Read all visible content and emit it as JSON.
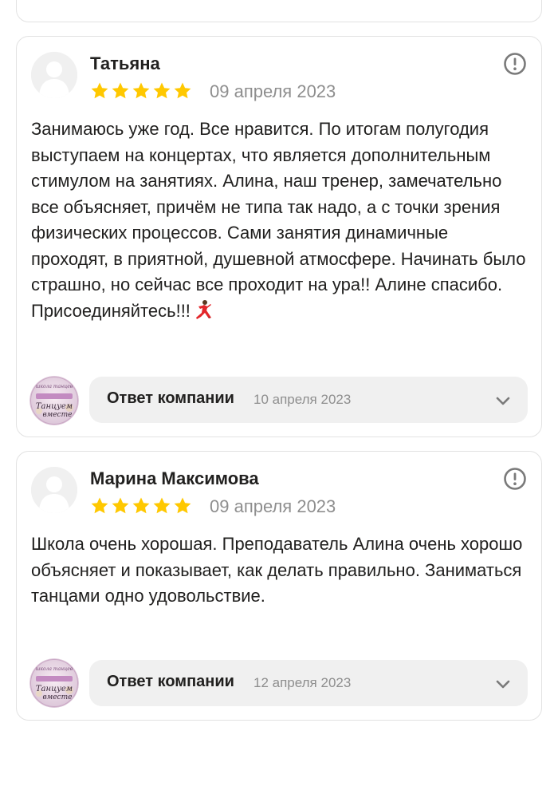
{
  "reviews": [
    {
      "author": "Татьяна",
      "rating": 5,
      "date": "09 апреля 2023",
      "text": "Занимаюсь уже год. Все нравится. По итогам полугодия выступаем на концертах, что является дополнительным стимулом на занятиях. Алина, наш тренер, замечательно все объясняет, причём не типа так надо, а с точки зрения физических процессов. Сами занятия динамичные проходят, в приятной, душевной атмосфере. Начинать было страшно, но сейчас все проходит на ура!! Алине спасибо. Присоединяйтесь!!!",
      "emoji": "dancer-emoji",
      "reply": {
        "label": "Ответ компании",
        "date": "10 апреля 2023"
      }
    },
    {
      "author": "Марина Максимова",
      "rating": 5,
      "date": "09 апреля 2023",
      "text": "Школа очень хорошая. Преподаватель Алина очень хорошо объясняет и показывает, как делать правильно. Заниматься танцами одно удовольствие.",
      "reply": {
        "label": "Ответ компании",
        "date": "12 апреля 2023"
      }
    }
  ],
  "company_logo": {
    "lines": [
      "школа танцев",
      "Танцуем",
      "вместе"
    ]
  },
  "icons": {
    "avatar": "user-placeholder-icon",
    "star": "star-icon",
    "report": "exclamation-circle-icon",
    "expand": "chevron-down-icon"
  },
  "colors": {
    "star": "#fc3f1d",
    "star_fill": "#ffc800",
    "muted_text": "#8e8e8e",
    "reply_bg": "#f0f0f0",
    "border": "#e2e2e2"
  }
}
